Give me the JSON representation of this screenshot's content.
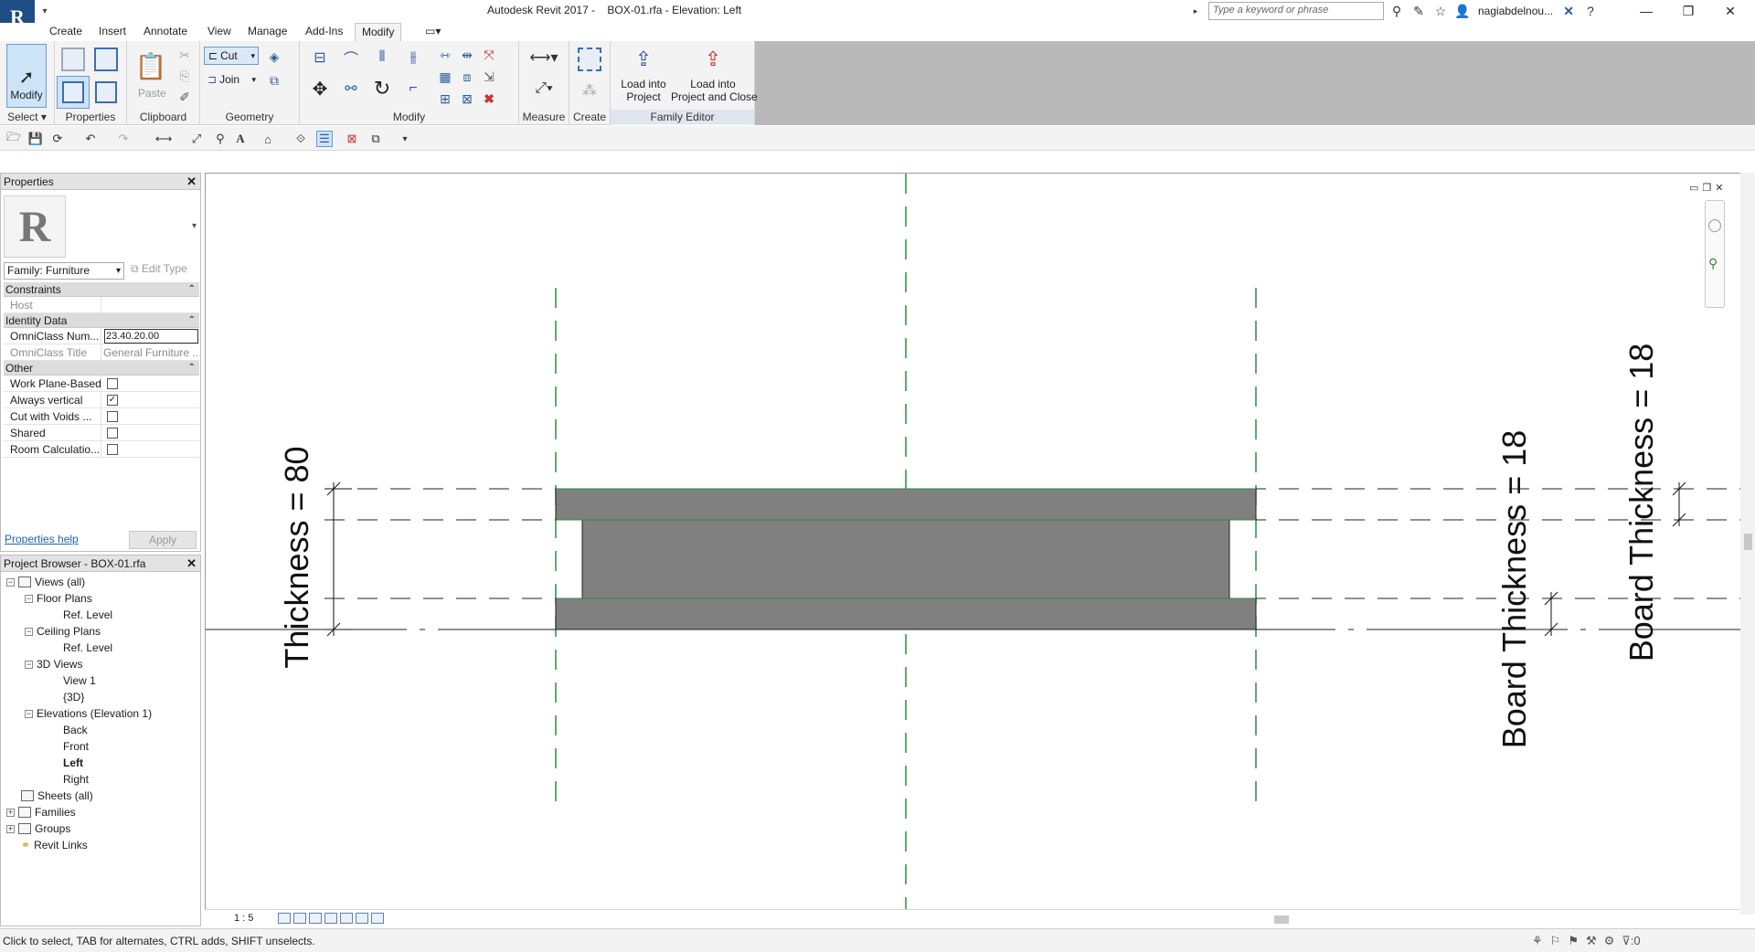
{
  "window": {
    "title": "Autodesk Revit 2017 -    BOX-01.rfa - Elevation: Left",
    "search_placeholder": "Type a keyword or phrase",
    "user": "nagiabdelnou...",
    "minimize": "—",
    "restore": "❐",
    "close": "✕"
  },
  "ribbon_tabs": [
    "Create",
    "Insert",
    "Annotate",
    "View",
    "Manage",
    "Add-Ins",
    "Modify"
  ],
  "ribbon": {
    "modify_label": "Modify",
    "select_label": "Select ▾",
    "properties_label": "Properties",
    "paste_label": "Paste",
    "clipboard_label": "Clipboard",
    "cut_label": "Cut",
    "join_label": "Join",
    "geometry_label": "Geometry",
    "modify_panel_label": "Modify",
    "measure_label": "Measure",
    "create_label": "Create",
    "load_into_project": "Load into\nProject",
    "load_into_project_close": "Load into\nProject and Close",
    "family_editor_label": "Family Editor"
  },
  "properties": {
    "header": "Properties",
    "family_select": "Family: Furniture",
    "edit_type": "Edit Type",
    "groups": {
      "constraints": "Constraints",
      "identity": "Identity Data",
      "other": "Other"
    },
    "rows": {
      "host_k": "Host",
      "host_v": "",
      "omni_num_k": "OmniClass Num...",
      "omni_num_v": "23.40.20.00",
      "omni_title_k": "OmniClass Title",
      "omni_title_v": "General Furniture ...",
      "wpb_k": "Work Plane-Based",
      "av_k": "Always vertical",
      "cwv_k": "Cut with Voids ...",
      "shared_k": "Shared",
      "room_k": "Room Calculatio..."
    },
    "checks": {
      "wpb": false,
      "av": true,
      "cwv": false,
      "shared": false,
      "room": false
    },
    "help": "Properties help",
    "apply": "Apply"
  },
  "browser": {
    "header": "Project Browser - BOX-01.rfa",
    "items": [
      "Views (all)",
      "Floor Plans",
      "Ref. Level",
      "Ceiling Plans",
      "Ref. Level",
      "3D Views",
      "View 1",
      "{3D}",
      "Elevations (Elevation 1)",
      "Back",
      "Front",
      "Left",
      "Right",
      "Sheets (all)",
      "Families",
      "Groups",
      "Revit Links"
    ]
  },
  "canvas": {
    "dim_thickness": "Thickness = 80",
    "dim_board1": "Board Thickness = 18",
    "dim_board2": "Board Thickness = 18"
  },
  "viewbar": {
    "scale": "1 : 5"
  },
  "status": {
    "text": "Click to select, TAB for alternates, CTRL adds, SHIFT unselects."
  },
  "colors": {
    "accent": "#1f4e86",
    "ref_plane": "#2e8b3d",
    "solid": "#808080"
  }
}
